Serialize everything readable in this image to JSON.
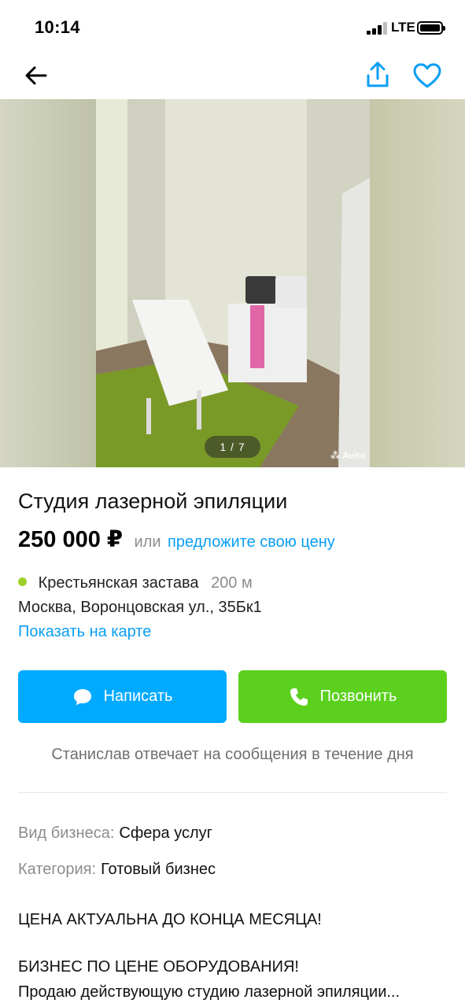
{
  "status_bar": {
    "time": "10:14",
    "network": "LTE"
  },
  "nav": {
    "back_icon": "arrow-left-icon",
    "share_icon": "share-icon",
    "favorite_icon": "heart-icon",
    "accent": "#0a9ef5"
  },
  "gallery": {
    "counter": "1 / 7",
    "watermark": "Avito"
  },
  "listing": {
    "title": "Студия лазерной эпиляции",
    "price": "250 000 ₽",
    "price_or": "или",
    "price_offer": "предложите свою цену"
  },
  "location": {
    "metro": "Крестьянская застава",
    "metro_distance": "200 м",
    "metro_color": "#9fd02a",
    "address": "Москва, Воронцовская ул., 35Бк1",
    "map_link": "Показать на карте"
  },
  "actions": {
    "write_label": "Написать",
    "write_color": "#00aaff",
    "call_label": "Позвонить",
    "call_color": "#5bd11e"
  },
  "seller": {
    "response_time": "Станислав отвечает на сообщения в течение дня"
  },
  "params": [
    {
      "key": "Вид бизнеса:",
      "value": "Сфера услуг"
    },
    {
      "key": "Категория:",
      "value": "Готовый бизнес"
    }
  ],
  "description": {
    "line1": "ЦЕНА АКТУАЛЬНА ДО КОНЦА МЕСЯЦА!",
    "line2": "БИЗНЕС ПО ЦЕНЕ ОБОРУДОВАНИЯ!",
    "line3": "Продаю действующую студию лазерной эпиляции..."
  }
}
